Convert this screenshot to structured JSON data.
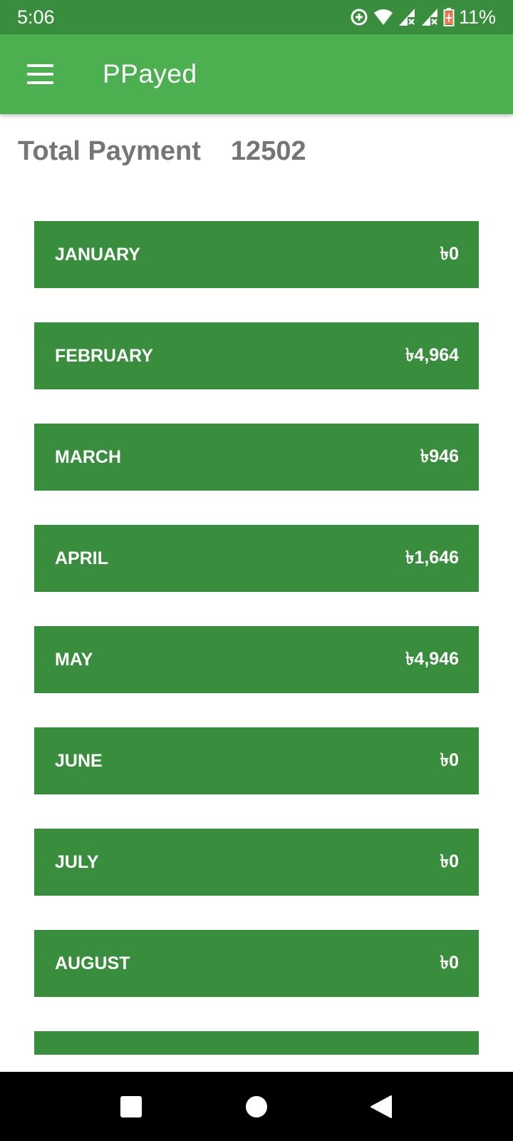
{
  "status_bar": {
    "time": "5:06",
    "battery_percent": "11%",
    "icons": [
      "sync-icon",
      "wifi-icon",
      "signal-no-data-icon",
      "signal-no-data-icon",
      "battery-low-icon"
    ]
  },
  "app_bar": {
    "title": "PPayed",
    "menu_icon": "hamburger-menu-icon"
  },
  "total": {
    "label": "Total Payment",
    "value": "12502"
  },
  "months": [
    {
      "name": "JANUARY",
      "amount": "৳0"
    },
    {
      "name": "FEBRUARY",
      "amount": "৳4,964"
    },
    {
      "name": "MARCH",
      "amount": "৳946"
    },
    {
      "name": "APRIL",
      "amount": "৳1,646"
    },
    {
      "name": "MAY",
      "amount": "৳4,946"
    },
    {
      "name": "JUNE",
      "amount": "৳0"
    },
    {
      "name": "JULY",
      "amount": "৳0"
    },
    {
      "name": "AUGUST",
      "amount": "৳0"
    }
  ],
  "colors": {
    "status_bar": "#388e3c",
    "app_bar": "#4caf50",
    "card": "#388e3c",
    "total_text": "#757575"
  },
  "nav_bar": {
    "icons": [
      "recents-square-icon",
      "home-circle-icon",
      "back-triangle-icon"
    ]
  }
}
